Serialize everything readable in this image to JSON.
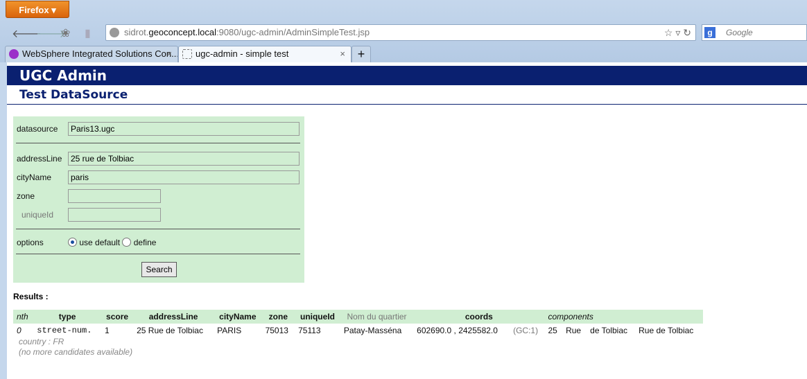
{
  "browser": {
    "menu_label": "Firefox",
    "url_prefix": "sidrot.",
    "url_host": "geoconcept.local",
    "url_rest": ":9080/ugc-admin/AdminSimpleTest.jsp",
    "search_placeholder": "Google",
    "tabs": [
      {
        "label": "WebSphere Integrated Solutions Con..."
      },
      {
        "label": "ugc-admin - simple test"
      }
    ],
    "new_tab": "+"
  },
  "header": {
    "title": "UGC Admin",
    "subtitle": "Test DataSource"
  },
  "form": {
    "datasource_label": "datasource",
    "datasource_value": "Paris13.ugc",
    "addressLine_label": "addressLine",
    "addressLine_value": "25 rue de Tolbiac",
    "cityName_label": "cityName",
    "cityName_value": "paris",
    "zone_label": "zone",
    "zone_value": "",
    "uniqueId_label": "uniqueId",
    "uniqueId_value": "",
    "options_label": "options",
    "option_default": "use default",
    "option_define": "define",
    "selected_option": "use default",
    "search_button": "Search"
  },
  "results": {
    "title": "Results :",
    "columns": [
      "nth",
      "type",
      "score",
      "addressLine",
      "cityName",
      "zone",
      "uniqueId",
      "Nom du quartier",
      "coords",
      "components"
    ],
    "rows": [
      {
        "nth": "0",
        "type": "street-num.",
        "score": "1",
        "addressLine": "25 Rue de Tolbiac",
        "cityName": "PARIS",
        "zone": "75013",
        "uniqueId": "75113",
        "quartier": "Patay-Masséna",
        "coords": "602690.0 , 2425582.0",
        "gc": "(GC:1)",
        "components": [
          "25",
          "Rue",
          "de Tolbiac",
          "Rue de Tolbiac"
        ]
      }
    ],
    "country": "country : FR",
    "no_more": "(no more candidates available)"
  }
}
